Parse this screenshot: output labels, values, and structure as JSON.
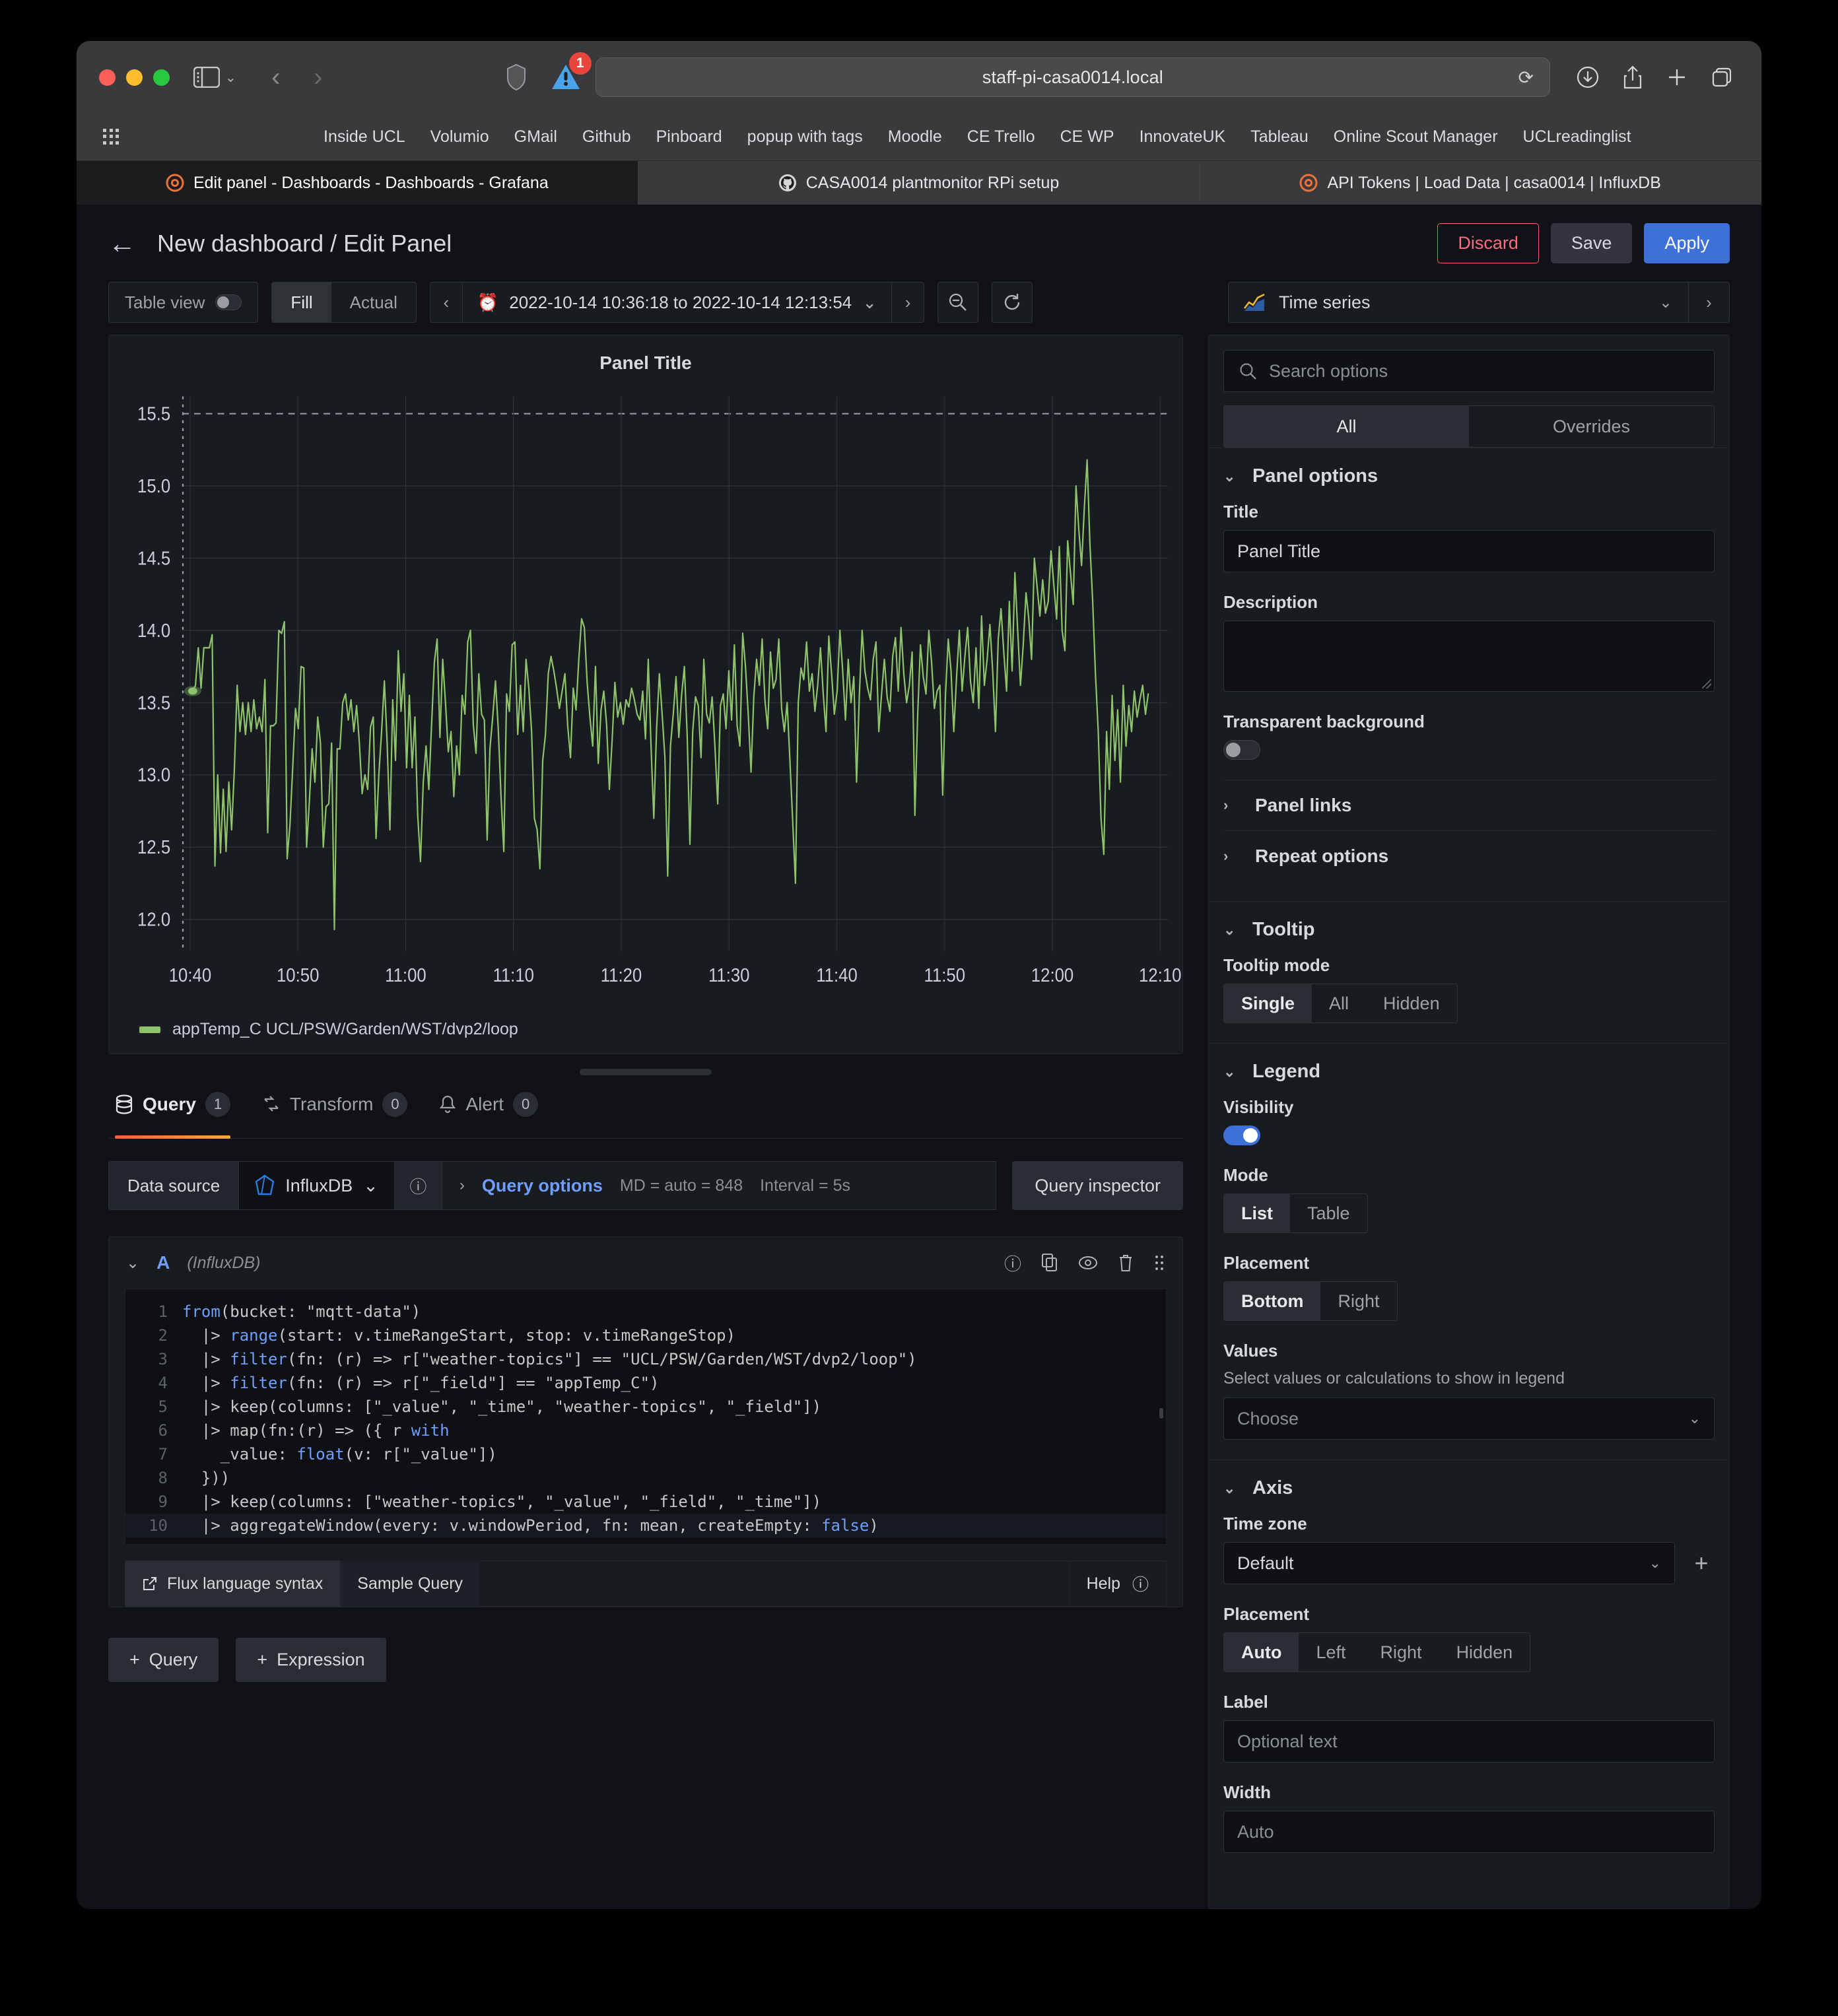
{
  "browser": {
    "url": "staff-pi-casa0014.local",
    "warning_badge": "1",
    "bookmarks": [
      "Inside UCL",
      "Volumio",
      "GMail",
      "Github",
      "Pinboard",
      "popup with tags",
      "Moodle",
      "CE Trello",
      "CE WP",
      "InnovateUK",
      "Tableau",
      "Online Scout Manager",
      "UCLreadinglist"
    ],
    "tabs": [
      {
        "title": "Edit panel - Dashboards - Dashboards - Grafana",
        "favicon": "grafana-icon",
        "active": true
      },
      {
        "title": "CASA0014 plantmonitor RPi setup",
        "favicon": "github-icon",
        "active": false
      },
      {
        "title": "API Tokens | Load Data | casa0014 | InfluxDB",
        "favicon": "influxdb-icon",
        "active": false
      }
    ],
    "icons": {
      "sidebar": "sidebar-toggle-icon",
      "back": "back-arrow-icon",
      "forward": "forward-arrow-icon",
      "shield": "privacy-shield-icon",
      "warning": "warning-triangle-icon",
      "reload": "reload-icon",
      "download": "download-icon",
      "share": "share-icon",
      "new_tab": "plus-icon",
      "tab_overview": "tab-overview-icon"
    }
  },
  "grafana": {
    "header": {
      "back_label": "back-arrow",
      "title": "New dashboard / Edit Panel",
      "discard_label": "Discard",
      "save_label": "Save",
      "apply_label": "Apply"
    },
    "toolbar": {
      "table_view_label": "Table view",
      "fill_label": "Fill",
      "actual_label": "Actual",
      "time_range": "2022-10-14 10:36:18 to 2022-10-14 12:13:54",
      "prev_label": "‹",
      "next_label": "›",
      "zoom_out_label": "zoom-out",
      "refresh_label": "refresh",
      "viz_name": "Time series"
    },
    "panel": {
      "title": "Panel Title",
      "legend_label": "appTemp_C UCL/PSW/Garden/WST/dvp2/loop",
      "series_color": "#8ec36c"
    },
    "query_tabs": [
      {
        "label": "Query",
        "count": "1",
        "icon": "database-icon",
        "active": true
      },
      {
        "label": "Transform",
        "count": "0",
        "icon": "transform-icon",
        "active": false
      },
      {
        "label": "Alert",
        "count": "0",
        "icon": "bell-icon",
        "active": false
      }
    ],
    "query": {
      "data_source_label": "Data source",
      "data_source_value": "InfluxDB",
      "help_icon": "question-circle-icon",
      "query_options_label": "Query options",
      "query_options_meta_md": "MD = auto = 848",
      "query_options_meta_interval": "Interval = 5s",
      "query_inspector_label": "Query inspector",
      "row_ref_id": "A",
      "row_ds_name": "(InfluxDB)",
      "row_icons": [
        "help-circle-icon",
        "duplicate-icon",
        "eye-icon",
        "trash-icon",
        "drag-handle-icon"
      ],
      "code_lines": [
        {
          "n": "1",
          "text": "from(bucket: \"mqtt-data\")"
        },
        {
          "n": "2",
          "text": "  |> range(start: v.timeRangeStart, stop: v.timeRangeStop)"
        },
        {
          "n": "3",
          "text": "  |> filter(fn: (r) => r[\"weather-topics\"] == \"UCL/PSW/Garden/WST/dvp2/loop\")"
        },
        {
          "n": "4",
          "text": "  |> filter(fn: (r) => r[\"_field\"] == \"appTemp_C\")"
        },
        {
          "n": "5",
          "text": "  |> keep(columns: [\"_value\", \"_time\", \"weather-topics\", \"_field\"])"
        },
        {
          "n": "6",
          "text": "  |> map(fn:(r) => ({ r with"
        },
        {
          "n": "7",
          "text": "    _value: float(v: r[\"_value\"])"
        },
        {
          "n": "8",
          "text": "  }))"
        },
        {
          "n": "9",
          "text": "  |> keep(columns: [\"weather-topics\", \"_value\", \"_field\", \"_time\"])"
        },
        {
          "n": "10",
          "text": "  |> aggregateWindow(every: v.windowPeriod, fn: mean, createEmpty: false)"
        }
      ],
      "flux_syntax_label": "Flux language syntax",
      "sample_query_label": "Sample Query",
      "help_label": "Help",
      "add_query_label": "Query",
      "add_expression_label": "Expression"
    },
    "options": {
      "search_placeholder": "Search options",
      "tabs": [
        {
          "label": "All",
          "active": true
        },
        {
          "label": "Overrides",
          "active": false
        }
      ],
      "panel_options": {
        "section_title": "Panel options",
        "title_label": "Title",
        "title_value": "Panel Title",
        "description_label": "Description",
        "description_value": "",
        "transparent_label": "Transparent background",
        "transparent_on": false,
        "panel_links_label": "Panel links",
        "repeat_options_label": "Repeat options"
      },
      "tooltip": {
        "section_title": "Tooltip",
        "mode_label": "Tooltip mode",
        "modes": [
          {
            "label": "Single",
            "active": true
          },
          {
            "label": "All",
            "active": false
          },
          {
            "label": "Hidden",
            "active": false
          }
        ]
      },
      "legend": {
        "section_title": "Legend",
        "visibility_label": "Visibility",
        "visibility_on": true,
        "mode_label": "Mode",
        "modes": [
          {
            "label": "List",
            "active": true
          },
          {
            "label": "Table",
            "active": false
          }
        ],
        "placement_label": "Placement",
        "placements": [
          {
            "label": "Bottom",
            "active": true
          },
          {
            "label": "Right",
            "active": false
          }
        ],
        "values_label": "Values",
        "values_help": "Select values or calculations to show in legend",
        "values_placeholder": "Choose"
      },
      "axis": {
        "section_title": "Axis",
        "timezone_label": "Time zone",
        "timezone_value": "Default",
        "placement_label": "Placement",
        "placements": [
          {
            "label": "Auto",
            "active": true
          },
          {
            "label": "Left",
            "active": false
          },
          {
            "label": "Right",
            "active": false
          },
          {
            "label": "Hidden",
            "active": false
          }
        ],
        "axis_label_label": "Label",
        "axis_label_placeholder": "Optional text",
        "width_label": "Width",
        "width_placeholder": "Auto"
      }
    }
  },
  "chart_data": {
    "type": "line",
    "title": "Panel Title",
    "xlabel": "",
    "ylabel": "",
    "ylim": [
      11.78,
      15.62
    ],
    "yticks": [
      12.0,
      12.5,
      13.0,
      13.5,
      14.0,
      14.5,
      15.0,
      15.5
    ],
    "xticks": [
      "10:40",
      "10:50",
      "11:00",
      "11:10",
      "11:20",
      "11:30",
      "11:40",
      "11:50",
      "12:00",
      "12:10"
    ],
    "grid": true,
    "legend_position": "bottom",
    "series": [
      {
        "name": "appTemp_C UCL/PSW/Garden/WST/dvp2/loop",
        "color": "#8ec36c",
        "values": [
          13.58,
          13.62,
          13.88,
          13.6,
          13.88,
          13.88,
          13.88,
          13.97,
          12.37,
          13.0,
          12.46,
          12.9,
          12.47,
          12.95,
          12.62,
          13.04,
          13.62,
          13.3,
          13.5,
          13.28,
          13.5,
          13.3,
          13.52,
          13.32,
          13.4,
          13.3,
          13.66,
          12.6,
          13.34,
          13.34,
          13.36,
          14.0,
          13.98,
          14.06,
          12.42,
          12.65,
          13.05,
          13.46,
          13.32,
          13.75,
          13.74,
          12.5,
          12.82,
          13.18,
          12.95,
          13.4,
          13.22,
          12.5,
          12.78,
          12.8,
          13.22,
          11.93,
          13.18,
          13.18,
          13.5,
          13.56,
          13.38,
          13.52,
          13.3,
          13.48,
          13.22,
          12.87,
          13.0,
          12.9,
          13.33,
          13.4,
          12.56,
          13.0,
          13.3,
          13.65,
          13.22,
          12.62,
          13.52,
          13.1,
          13.86,
          13.44,
          13.7,
          13.05,
          13.55,
          13.05,
          13.4,
          12.72,
          12.4,
          12.95,
          13.2,
          12.9,
          13.35,
          13.78,
          13.94,
          13.26,
          13.8,
          13.5,
          13.16,
          13.3,
          12.85,
          13.2,
          13.0,
          13.55,
          13.42,
          13.92,
          14.0,
          13.35,
          13.15,
          13.7,
          13.42,
          13.38,
          12.55,
          13.18,
          13.4,
          13.65,
          13.32,
          12.85,
          12.47,
          13.56,
          13.44,
          13.9,
          13.92,
          13.28,
          13.62,
          13.3,
          13.8,
          13.6,
          13.3,
          12.7,
          12.62,
          12.35,
          13.1,
          13.28,
          13.7,
          13.82,
          13.72,
          13.6,
          13.46,
          13.58,
          13.7,
          13.34,
          13.12,
          13.6,
          13.45,
          13.8,
          14.08,
          14.02,
          13.64,
          13.4,
          13.2,
          13.75,
          13.08,
          13.45,
          13.58,
          13.35,
          12.9,
          13.24,
          13.64,
          13.4,
          13.5,
          13.35,
          13.52,
          13.47,
          13.6,
          13.52,
          13.42,
          13.38,
          13.58,
          13.25,
          13.8,
          13.2,
          12.7,
          13.32,
          13.7,
          13.42,
          13.12,
          12.3,
          13.2,
          13.42,
          13.68,
          13.26,
          13.55,
          13.75,
          13.28,
          12.52,
          13.3,
          13.54,
          13.48,
          13.12,
          13.8,
          13.42,
          13.36,
          13.54,
          13.2,
          12.8,
          13.48,
          13.56,
          13.32,
          13.72,
          13.38,
          13.9,
          13.34,
          13.2,
          13.98,
          13.75,
          13.42,
          13.02,
          13.54,
          13.8,
          13.62,
          13.94,
          13.52,
          13.32,
          13.85,
          13.6,
          13.66,
          13.94,
          13.46,
          13.3,
          13.5,
          13.1,
          12.68,
          12.25,
          13.5,
          13.74,
          13.66,
          13.92,
          13.58,
          13.7,
          13.44,
          13.62,
          13.88,
          13.56,
          13.3,
          13.96,
          13.7,
          13.42,
          13.58,
          14.0,
          13.72,
          13.38,
          13.8,
          13.5,
          13.68,
          12.95,
          13.55,
          14.0,
          13.72,
          13.6,
          13.52,
          13.8,
          13.92,
          13.3,
          13.56,
          13.8,
          13.54,
          13.44,
          13.82,
          13.95,
          13.58,
          14.02,
          13.7,
          13.5,
          13.62,
          13.85,
          12.72,
          13.42,
          13.9,
          13.68,
          13.56,
          14.0,
          13.78,
          13.46,
          13.58,
          13.62,
          12.86,
          13.55,
          13.94,
          13.72,
          13.3,
          13.68,
          14.0,
          13.58,
          13.82,
          14.02,
          13.65,
          13.5,
          13.88,
          13.46,
          14.1,
          13.62,
          13.8,
          14.04,
          13.72,
          13.3,
          13.94,
          14.15,
          13.85,
          13.58,
          14.2,
          13.72,
          14.4,
          14.0,
          13.62,
          13.9,
          14.26,
          14.08,
          13.8,
          14.5,
          14.3,
          14.1,
          14.35,
          14.12,
          14.2,
          14.55,
          14.32,
          14.08,
          14.58,
          14.0,
          13.86,
          14.62,
          14.4,
          14.18,
          15.0,
          14.7,
          14.45,
          14.85,
          15.18,
          14.6,
          14.2,
          13.7,
          13.3,
          12.7,
          12.45,
          13.3,
          12.9,
          13.55,
          13.1,
          13.45,
          12.95,
          13.62,
          13.2,
          13.48,
          13.3,
          13.58,
          13.4,
          13.52,
          13.62,
          13.42,
          13.56
        ]
      }
    ]
  }
}
